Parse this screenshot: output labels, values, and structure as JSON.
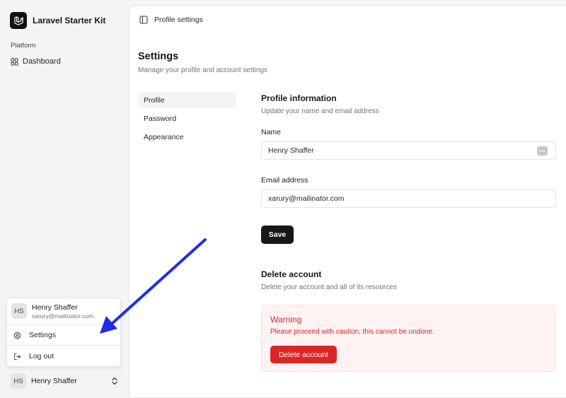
{
  "app": {
    "name": "Laravel Starter Kit"
  },
  "sidebar": {
    "group_label": "Platform",
    "items": [
      {
        "label": "Dashboard",
        "icon": "layout-grid-icon"
      }
    ],
    "user": {
      "initials": "HS",
      "name": "Henry Shaffer",
      "icon": "chevrons-up-down-icon"
    }
  },
  "user_menu": {
    "initials": "HS",
    "name": "Henry Shaffer",
    "email": "xarury@mailinator.com",
    "items": [
      {
        "label": "Settings",
        "icon": "gear-icon"
      },
      {
        "label": "Log out",
        "icon": "log-out-icon"
      }
    ]
  },
  "header": {
    "breadcrumb": "Profile settings",
    "icon": "sidebar-toggle-icon"
  },
  "settings": {
    "title": "Settings",
    "subtitle": "Manage your profile and account settings",
    "nav": [
      {
        "label": "Profile",
        "active": true
      },
      {
        "label": "Password",
        "active": false
      },
      {
        "label": "Appearance",
        "active": false
      }
    ]
  },
  "profile": {
    "title": "Profile information",
    "subtitle": "Update your name and email address",
    "name_label": "Name",
    "name_value": "Henry Shaffer",
    "email_label": "Email address",
    "email_value": "xarury@mailinator.com",
    "save_label": "Save"
  },
  "delete_account": {
    "title": "Delete account",
    "subtitle": "Delete your account and all of its resources",
    "warning_title": "Warning",
    "warning_text": "Please proceed with caution, this cannot be undone.",
    "button_label": "Delete account"
  },
  "colors": {
    "primary": "#18181b",
    "danger": "#dc2626",
    "danger_bg": "#fef2f2",
    "annotation_arrow": "#1f2ee8"
  }
}
